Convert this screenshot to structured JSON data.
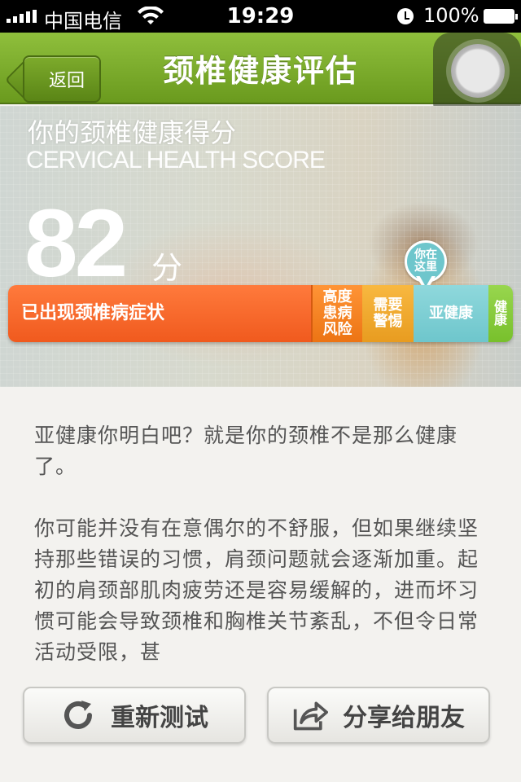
{
  "status_bar": {
    "carrier": "中国电信",
    "time": "19:29",
    "battery": "100%"
  },
  "nav": {
    "back_label": "返回",
    "title": "颈椎健康评估"
  },
  "hero": {
    "title_cn": "你的颈椎健康得分",
    "title_en": "CERVICAL HEALTH SCORE",
    "score": "82",
    "unit": "分"
  },
  "scale": {
    "segments": [
      {
        "label": "已出现颈椎病症状",
        "color": "#f05a1e"
      },
      {
        "label": "高度患病风险",
        "color": "#ec7414"
      },
      {
        "label": "需要警惕",
        "color": "#e89c20"
      },
      {
        "label": "亚健康",
        "color": "#6ec6cc"
      },
      {
        "label": "健康",
        "color": "#78c02c"
      }
    ],
    "marker_label": "你在这里",
    "current_segment": "亚健康"
  },
  "description": {
    "paragraphs": [
      "亚健康你明白吧？就是你的颈椎不是那么健康了。",
      "你可能并没有在意偶尔的不舒服，但如果继续坚持那些错误的习惯，肩颈问题就会逐渐加重。起初的肩颈部肌肉疲劳还是容易缓解的，进而坏习惯可能会导致颈椎和胸椎关节紊乱，不但令日常活动受限，甚"
    ]
  },
  "actions": {
    "retest_label": "重新测试",
    "share_label": "分享给朋友"
  }
}
